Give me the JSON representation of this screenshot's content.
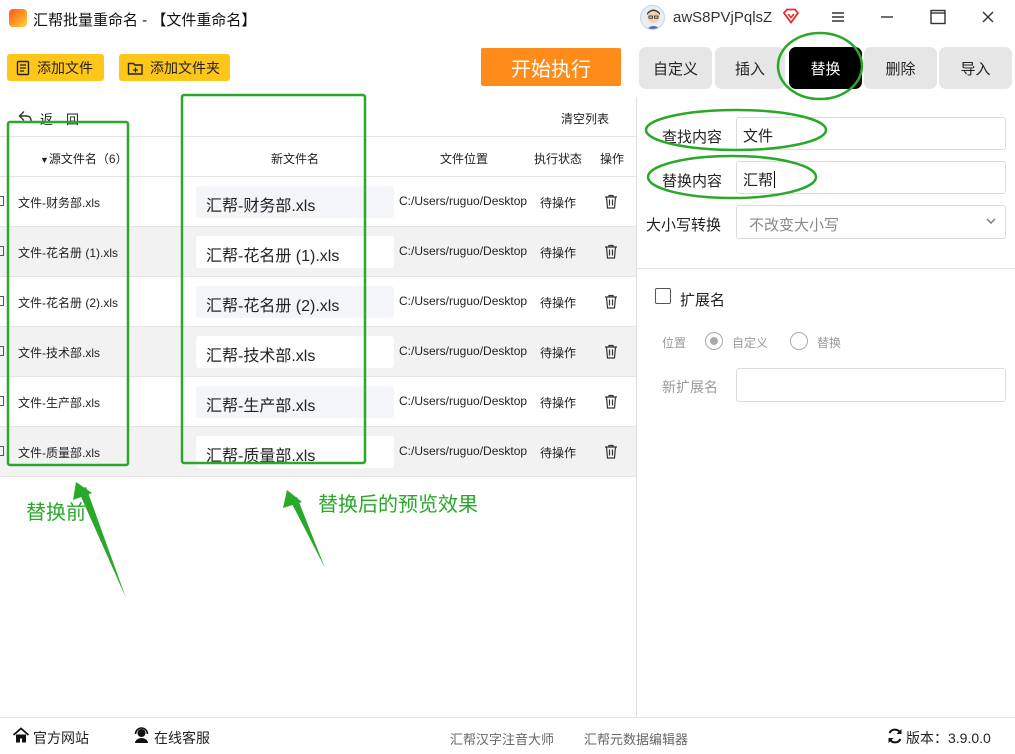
{
  "window": {
    "title": "汇帮批量重命名 - 【文件重命名】",
    "username": "awS8PVjPqlsZ"
  },
  "toolbar": {
    "add_file": "添加文件",
    "add_folder": "添加文件夹",
    "start": "开始执行"
  },
  "tabs": [
    {
      "label": "自定义",
      "active": false
    },
    {
      "label": "插入",
      "active": false
    },
    {
      "label": "替换",
      "active": true
    },
    {
      "label": "删除",
      "active": false
    },
    {
      "label": "导入",
      "active": false
    }
  ],
  "list": {
    "back": "返　回",
    "clear": "清空列表",
    "columns": {
      "source": "源文件名（6）",
      "new_name": "新文件名",
      "location": "文件位置",
      "status": "执行状态",
      "action": "操作"
    },
    "rows": [
      {
        "source": "文件-财务部.xls",
        "new_name": "汇帮-财务部.xls",
        "path": "C:/Users/ruguo/Desktop",
        "status": "待操作"
      },
      {
        "source": "文件-花名册 (1).xls",
        "new_name": "汇帮-花名册 (1).xls",
        "path": "C:/Users/ruguo/Desktop",
        "status": "待操作"
      },
      {
        "source": "文件-花名册 (2).xls",
        "new_name": "汇帮-花名册 (2).xls",
        "path": "C:/Users/ruguo/Desktop",
        "status": "待操作"
      },
      {
        "source": "文件-技术部.xls",
        "new_name": "汇帮-技术部.xls",
        "path": "C:/Users/ruguo/Desktop",
        "status": "待操作"
      },
      {
        "source": "文件-生产部.xls",
        "new_name": "汇帮-生产部.xls",
        "path": "C:/Users/ruguo/Desktop",
        "status": "待操作"
      },
      {
        "source": "文件-质量部.xls",
        "new_name": "汇帮-质量部.xls",
        "path": "C:/Users/ruguo/Desktop",
        "status": "待操作"
      }
    ]
  },
  "replace_panel": {
    "find_label": "查找内容",
    "find_value": "文件",
    "replace_label": "替换内容",
    "replace_value": "汇帮",
    "case_label": "大小写转换",
    "case_value": "不改变大小写",
    "ext_label": "扩展名",
    "position_label": "位置",
    "option_custom": "自定义",
    "option_replace": "替换",
    "new_ext_label": "新扩展名"
  },
  "statusbar": {
    "website": "官方网站",
    "support": "在线客服",
    "link1": "汇帮汉字注音大师",
    "link2": "汇帮元数据编辑器",
    "version": "版本：3.9.0.0"
  },
  "annotations": {
    "before": "替换前",
    "after": "替换后的预览效果"
  },
  "colors": {
    "accent_yellow": "#ffc61a",
    "start_orange": "#ff8c1a",
    "annotation_green": "#2aa82a"
  }
}
